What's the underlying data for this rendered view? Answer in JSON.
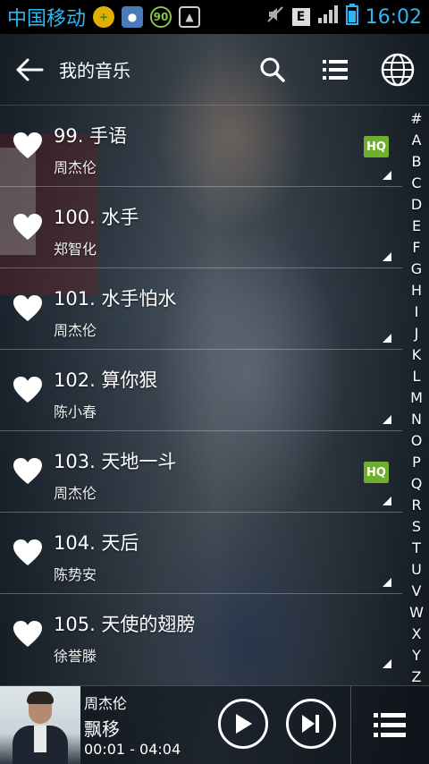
{
  "status_bar": {
    "carrier": "中国移动",
    "network": "E",
    "time": "16:02",
    "badge": "90"
  },
  "app_bar": {
    "title": "我的音乐"
  },
  "songs": [
    {
      "title": "99. 手语",
      "artist": "周杰伦",
      "hq": true
    },
    {
      "title": "100. 水手",
      "artist": "郑智化",
      "hq": false
    },
    {
      "title": "101. 水手怕水",
      "artist": "周杰伦",
      "hq": false
    },
    {
      "title": "102. 算你狠",
      "artist": "陈小春",
      "hq": false
    },
    {
      "title": "103. 天地一斗",
      "artist": "周杰伦",
      "hq": true
    },
    {
      "title": "104. 天后",
      "artist": "陈势安",
      "hq": false
    },
    {
      "title": "105. 天使的翅膀",
      "artist": "徐誉滕",
      "hq": false
    }
  ],
  "hq_label": "HQ",
  "alphabet_index": [
    "#",
    "A",
    "B",
    "C",
    "D",
    "E",
    "F",
    "G",
    "H",
    "I",
    "J",
    "K",
    "L",
    "M",
    "N",
    "O",
    "P",
    "Q",
    "R",
    "S",
    "T",
    "U",
    "V",
    "W",
    "X",
    "Y",
    "Z"
  ],
  "player": {
    "artist": "周杰伦",
    "title": "飘移",
    "time": "00:01 - 04:04"
  },
  "colors": {
    "accent_blue": "#2db6f0",
    "hq_green": "#6fae2f"
  }
}
